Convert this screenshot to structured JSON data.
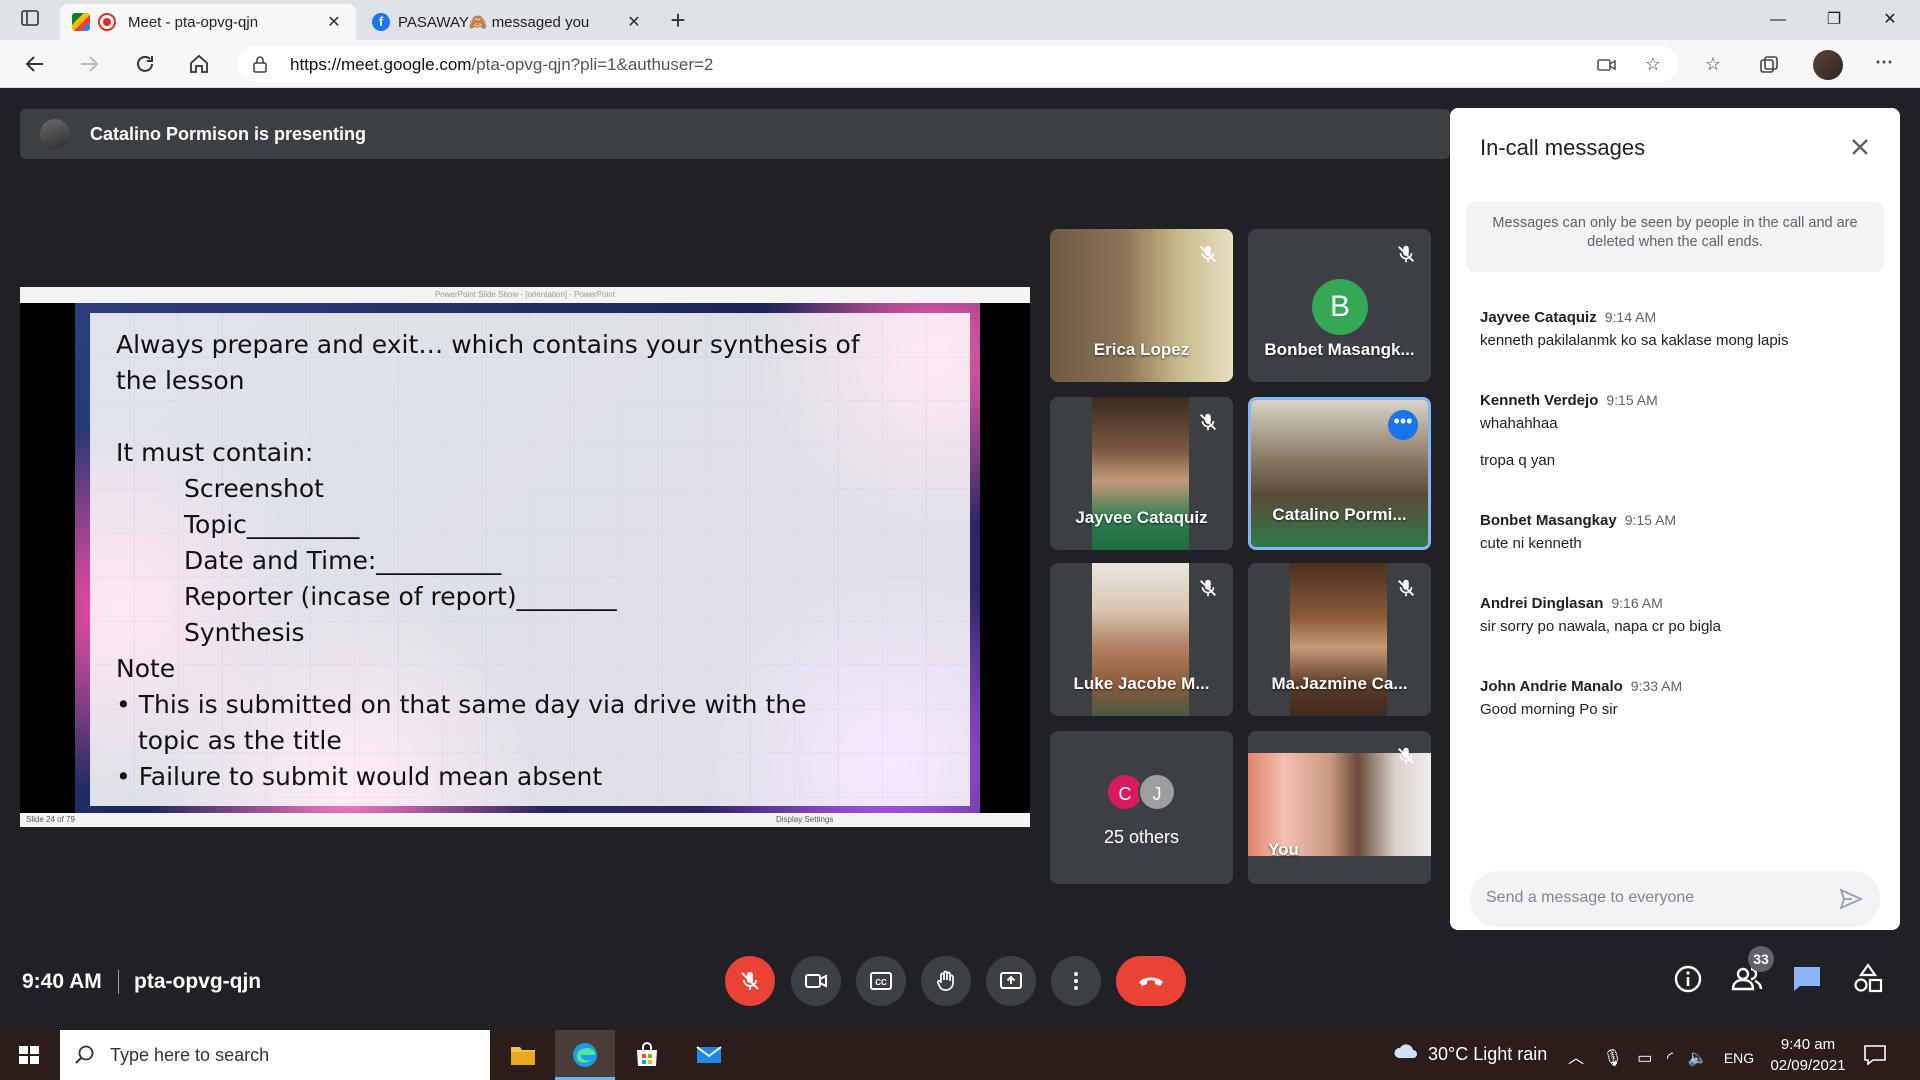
{
  "browser": {
    "tabs": [
      {
        "title": "Meet - pta-opvg-qjn",
        "active": true
      },
      {
        "title": "PASAWAY🙈 messaged you",
        "active": false
      }
    ],
    "url_host": "https://meet.google.com",
    "url_path": "/pta-opvg-qjn?pli=1&authuser=2"
  },
  "meet": {
    "presenter_banner": "Catalino Pormison is presenting",
    "slide": {
      "window_title": "PowerPoint Slide Show - [orientation] - PowerPoint",
      "lines": [
        "Always prepare and exit… which contains your synthesis of",
        "the lesson",
        "",
        "It must contain:"
      ],
      "items": [
        "Screenshot",
        "Topic_________",
        "Date and Time:__________",
        "Reporter (incase of report)________",
        "Synthesis"
      ],
      "note_label": "Note",
      "bullets": [
        "This is submitted on that same day via drive with the topic as the title",
        "Failure to submit would mean absent"
      ],
      "slide_counter": "Slide 24 of 79",
      "display_settings": "Display Settings"
    },
    "participants": [
      {
        "name": "Erica Lopez",
        "muted": true
      },
      {
        "name": "Bonbet Masangk...",
        "muted": true,
        "initial": "B",
        "avatar_color": "#34a853"
      },
      {
        "name": "Jayvee Cataquiz",
        "muted": true
      },
      {
        "name": "Catalino Pormi...",
        "muted": false,
        "speaking": true
      },
      {
        "name": "Luke Jacobe M...",
        "muted": true
      },
      {
        "name": "Ma.Jazmine Ca...",
        "muted": true
      },
      {
        "name": "25 others",
        "initials": [
          "C",
          "J"
        ],
        "initial_colors": [
          "#d81b60",
          "#9e9e9e"
        ]
      },
      {
        "name": "You",
        "muted": true
      }
    ],
    "chat": {
      "title": "In-call messages",
      "notice": "Messages can only be seen by people in the call and are deleted when the call ends.",
      "messages": [
        {
          "sender": "Jayvee Cataquiz",
          "time": "9:14 AM",
          "text": "kenneth pakilalanmk ko sa kaklase mong lapis"
        },
        {
          "sender": "Kenneth Verdejo",
          "time": "9:15 AM",
          "text": "whahahhaa",
          "text2": "tropa q yan"
        },
        {
          "sender": "Bonbet Masangkay",
          "time": "9:15 AM",
          "text": "cute ni kenneth"
        },
        {
          "sender": "Andrei Dinglasan",
          "time": "9:16 AM",
          "text": "sir sorry po nawala, napa cr po bigla"
        },
        {
          "sender": "John Andrie Manalo",
          "time": "9:33 AM",
          "text": "Good morning Po sir"
        }
      ],
      "input_placeholder": "Send a message to everyone"
    },
    "bottom": {
      "time": "9:40 AM",
      "meeting_code": "pta-opvg-qjn",
      "people_count": "33"
    }
  },
  "taskbar": {
    "search_placeholder": "Type here to search",
    "weather": "30°C  Light rain",
    "language": "ENG",
    "clock_time": "9:40 am",
    "clock_date": "02/09/2021"
  },
  "colors": {
    "meet_bg": "#202124",
    "tile_bg": "#3c4043",
    "danger": "#ea4335",
    "accent": "#1a73e8"
  }
}
